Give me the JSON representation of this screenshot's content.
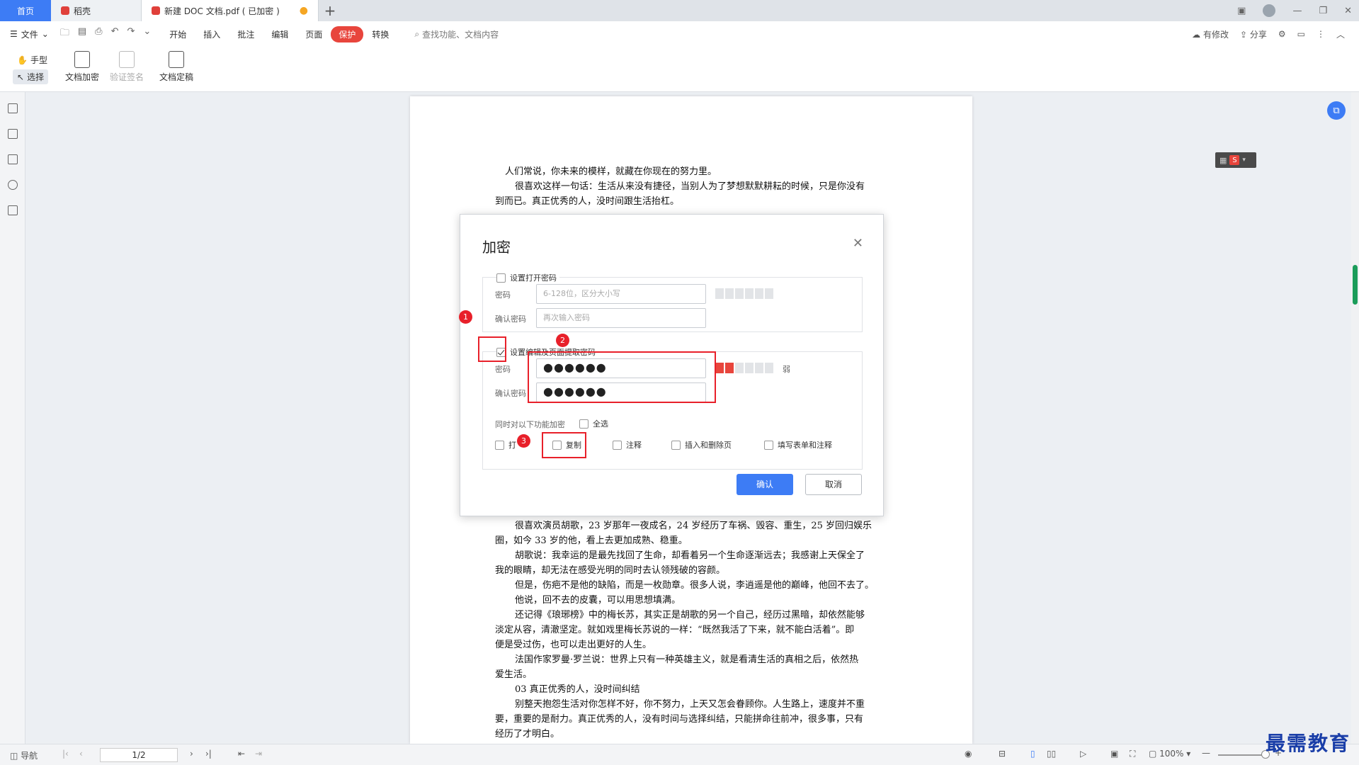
{
  "tabs": {
    "home": "首页",
    "daoke": "稻壳",
    "doc": "新建 DOC 文档.pdf ( 已加密 )",
    "add": "+"
  },
  "menubar": {
    "file": "文件",
    "items": [
      "开始",
      "插入",
      "批注",
      "编辑",
      "页面",
      "保护",
      "转换"
    ],
    "active": "保护",
    "search_placeholder": "查找功能、文档内容",
    "has_edits": "有修改",
    "share": "分享"
  },
  "ribbon": {
    "hand": "手型",
    "select": "选择",
    "encrypt": "文档加密",
    "verify_sign": "验证签名",
    "finalize": "文档定稿"
  },
  "document": {
    "lines_top": [
      "人们常说，你未来的模样，就藏在你现在的努力里。",
      "很喜欢这样一句话：生活从来没有捷径，当别人为了梦想默默耕耘的时候，只是你没有",
      "到而已。真正优秀的人，没时间跟生活抬杠。"
    ],
    "lines_bottom": [
      "很喜欢演员胡歌，23 岁那年一夜成名，24 岁经历了车祸、毁容、重生，25 岁回归娱乐",
      "圈，如今 33 岁的他，看上去更加成熟、稳重。",
      "胡歌说：我幸运的是最先找回了生命，却看着另一个生命逐渐远去；我感谢上天保全了",
      "我的眼睛，却无法在感受光明的同时去认领残破的容颜。",
      "但是，伤疤不是他的缺陷，而是一枚勋章。很多人说，李逍遥是他的巅峰，他回不去了。",
      "他说，回不去的皮囊，可以用思想填满。",
      "还记得《琅琊榜》中的梅长苏，其实正是胡歌的另一个自己，经历过黑暗，却依然能够",
      "淡定从容，清澈坚定。就如戏里梅长苏说的一样：“既然我活了下来，就不能白活着”。即",
      "便是受过伤，也可以走出更好的人生。",
      "法国作家罗曼·罗兰说：世界上只有一种英雄主义，就是看清生活的真相之后，依然热",
      "爱生活。",
      "03 真正优秀的人，没时间纠结",
      "别整天抱怨生活对你怎样不好，你不努力，上天又怎会眷顾你。人生路上，速度并不重",
      "要，重要的是耐力。真正优秀的人，没有时间与选择纠结，只能拼命往前冲，很多事，只有",
      "经历了才明白。"
    ]
  },
  "dialog": {
    "title": "加密",
    "open_pw_label": "设置打开密码",
    "pw_label": "密码",
    "confirm_label": "确认密码",
    "pw_placeholder": "6-128位，区分大小写",
    "confirm_placeholder": "再次输入密码",
    "edit_pw_label": "设置编辑及页面提取密码",
    "edit_pw_value": "●●●●●●",
    "edit_confirm_value": "●●●●●●",
    "strength_text": "弱",
    "func_label": "同时对以下功能加密",
    "select_all": "全选",
    "options": [
      "打",
      "复制",
      "注释",
      "插入和删除页",
      "填写表单和注释"
    ],
    "ok": "确认",
    "cancel": "取消",
    "badges": [
      "1",
      "2",
      "3"
    ]
  },
  "statusbar": {
    "nav": "导航",
    "page": "1/2",
    "zoom": "100%"
  },
  "watermark": "最需教育",
  "colors": {
    "accent": "#3d7cf5",
    "protect_tab": "#e8453c",
    "annotation_red": "#e8202a"
  }
}
